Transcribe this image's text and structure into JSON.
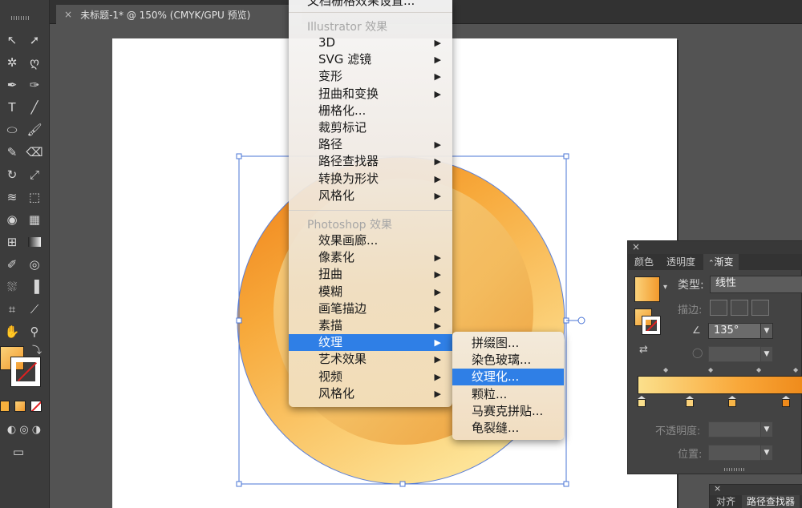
{
  "document_tab": {
    "close": "×",
    "title": "未标题-1* @ 150% (CMYK/GPU 预览)"
  },
  "effect_menu": {
    "top_item": "文档栅格效果设置...",
    "illustrator_header": "Illustrator 效果",
    "illustrator_items": [
      {
        "label": "3D",
        "submenu": true
      },
      {
        "label": "SVG 滤镜",
        "submenu": true
      },
      {
        "label": "变形",
        "submenu": true
      },
      {
        "label": "扭曲和变换",
        "submenu": true
      },
      {
        "label": "栅格化...",
        "submenu": false
      },
      {
        "label": "裁剪标记",
        "submenu": false
      },
      {
        "label": "路径",
        "submenu": true
      },
      {
        "label": "路径查找器",
        "submenu": true
      },
      {
        "label": "转换为形状",
        "submenu": true
      },
      {
        "label": "风格化",
        "submenu": true
      }
    ],
    "photoshop_header": "Photoshop 效果",
    "photoshop_items": [
      {
        "label": "效果画廊...",
        "submenu": false
      },
      {
        "label": "像素化",
        "submenu": true
      },
      {
        "label": "扭曲",
        "submenu": true
      },
      {
        "label": "模糊",
        "submenu": true
      },
      {
        "label": "画笔描边",
        "submenu": true
      },
      {
        "label": "素描",
        "submenu": true
      },
      {
        "label": "纹理",
        "submenu": true,
        "highlighted": true
      },
      {
        "label": "艺术效果",
        "submenu": true
      },
      {
        "label": "视频",
        "submenu": true
      },
      {
        "label": "风格化",
        "submenu": true
      }
    ],
    "arrow_glyph": "▶"
  },
  "texture_submenu": {
    "items": [
      {
        "label": "拼缀图..."
      },
      {
        "label": "染色玻璃..."
      },
      {
        "label": "纹理化...",
        "highlighted": true
      },
      {
        "label": "颗粒..."
      },
      {
        "label": "马赛克拼贴..."
      },
      {
        "label": "龟裂缝..."
      }
    ]
  },
  "gradient_panel": {
    "close": "×",
    "tabs": [
      "颜色",
      "透明度",
      "渐变"
    ],
    "active_tab": "渐变",
    "type_label": "类型:",
    "type_value": "线性",
    "stroke_label": "描边:",
    "angle_value": "135°",
    "opacity_label": "不透明度:",
    "location_label": "位置:",
    "gradient_colors": [
      "#fbe08c",
      "#f9a83a",
      "#ef8a1a"
    ]
  },
  "pathfinder_panel": {
    "close": "×",
    "tabs": [
      "对齐",
      "路径查找器"
    ]
  },
  "tools": [
    "selection-tool",
    "direct-selection-tool",
    "magic-wand-tool",
    "lasso-tool",
    "pen-tool",
    "curvature-tool",
    "type-tool",
    "line-tool",
    "ellipse-tool",
    "paintbrush-tool",
    "pencil-tool",
    "eraser-tool",
    "rotate-tool",
    "scale-tool",
    "warp-tool",
    "free-transform-tool",
    "shape-builder-tool",
    "perspective-grid-tool",
    "mesh-tool",
    "gradient-tool",
    "eyedropper-tool",
    "blend-tool",
    "symbol-sprayer-tool",
    "column-graph-tool",
    "artboard-tool",
    "slice-tool",
    "hand-tool",
    "zoom-tool"
  ],
  "colors": {
    "accent": "#2f7fe6",
    "outer_circle_top": "#f7a93b",
    "outer_circle_bottom": "#fde396",
    "inner_circle": "#f3bb5e",
    "selection": "#4a74d6"
  }
}
